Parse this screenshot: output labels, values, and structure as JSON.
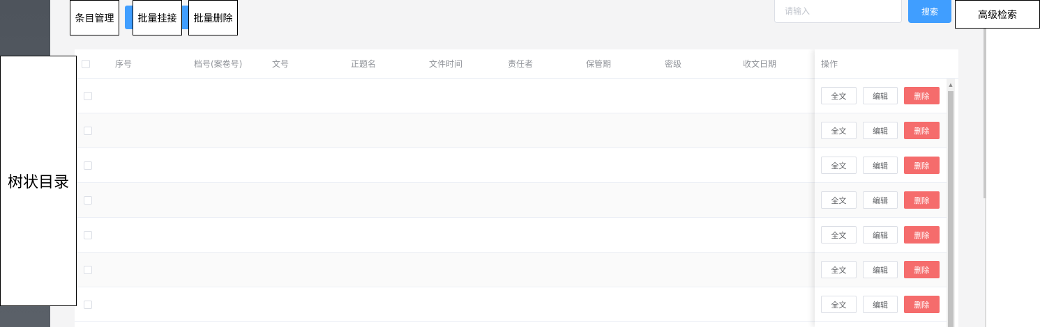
{
  "toolbar": {
    "entry_manage": "条目管理",
    "batch_attach": "批量挂接",
    "batch_delete": "批量删除",
    "search_placeholder": "请输入",
    "search": "搜索",
    "advanced_search": "高级检索"
  },
  "tree": {
    "label": "树状目录"
  },
  "table": {
    "columns": [
      "序号",
      "档号(案卷号)",
      "文号",
      "正题名",
      "文件时间",
      "责任者",
      "保管期",
      "密级",
      "收文日期"
    ],
    "ops_header": "操作",
    "row_actions": {
      "fulltext": "全文",
      "edit": "编辑",
      "delete": "删除"
    },
    "row_count": 7
  },
  "colors": {
    "primary": "#409eff",
    "danger": "#f56c6c",
    "sidebar": "#4e545c"
  }
}
